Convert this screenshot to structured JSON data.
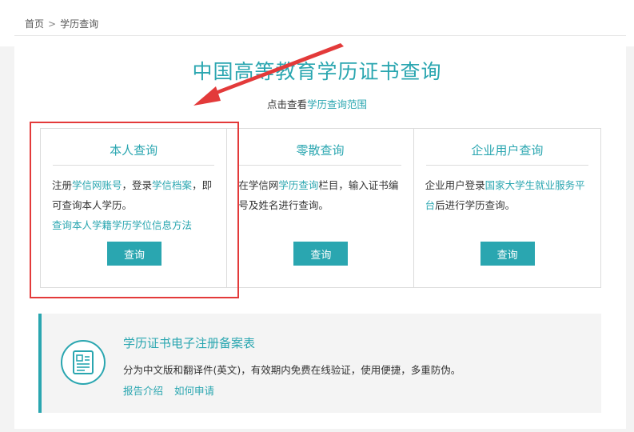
{
  "breadcrumb": {
    "home": "首页",
    "separator": ">",
    "current": "学历查询"
  },
  "header": {
    "title": "中国高等教育学历证书查询",
    "subtitle_prefix": "点击查看",
    "subtitle_link": "学历查询范围"
  },
  "cards": [
    {
      "title": "本人查询",
      "desc_parts": [
        "注册",
        "学信网账号",
        "，登录",
        "学信档案",
        "，即可查询本人学历。"
      ],
      "extra_link": "查询本人学籍学历学位信息方法",
      "button": "查询"
    },
    {
      "title": "零散查询",
      "desc_parts": [
        "在学信网",
        "学历查询",
        "栏目，输入证书编号及姓名进行查询。"
      ],
      "button": "查询"
    },
    {
      "title": "企业用户查询",
      "desc_parts": [
        "企业用户登录",
        "国家大学生就业服务平台",
        "后进行学历查询。"
      ],
      "button": "查询"
    }
  ],
  "certificate": {
    "title": "学历证书电子注册备案表",
    "description": "分为中文版和翻译件(英文)，有效期内免费在线验证，使用便捷，多重防伪。",
    "links": [
      "报告介绍",
      "如何申请"
    ],
    "icon": "certificate-document-icon"
  },
  "colors": {
    "accent": "#2aa6b0",
    "highlight": "#e33a3a"
  }
}
